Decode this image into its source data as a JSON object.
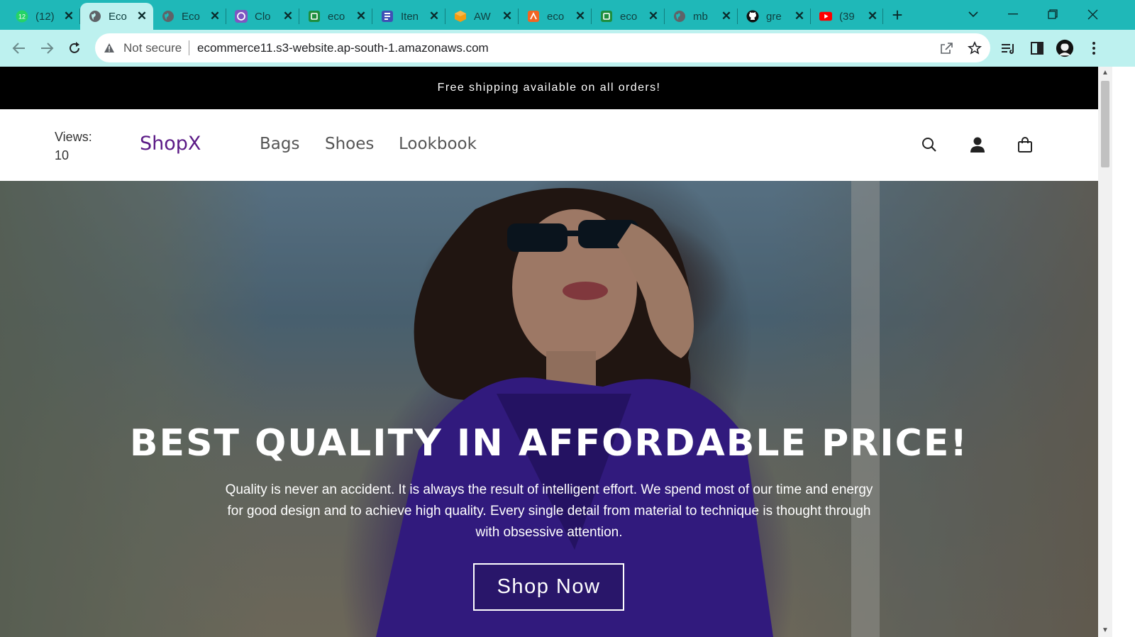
{
  "browser": {
    "tabs": [
      {
        "title": "(12)",
        "icon": "whatsapp-icon",
        "color": "#25d366"
      },
      {
        "title": "Eco",
        "icon": "globe-icon",
        "color": "#5f6368",
        "active": true
      },
      {
        "title": "Eco",
        "icon": "globe-icon",
        "color": "#5f6368"
      },
      {
        "title": "Clo",
        "icon": "cloud-app-icon",
        "color": "#7e57c2"
      },
      {
        "title": "eco",
        "icon": "green-store-icon",
        "color": "#1e8e3e"
      },
      {
        "title": "Iten",
        "icon": "doc-icon",
        "color": "#3f51b5"
      },
      {
        "title": "AW",
        "icon": "aws-cube-icon",
        "color": "#f39c12"
      },
      {
        "title": "eco",
        "icon": "rss-icon",
        "color": "#f26522"
      },
      {
        "title": "eco",
        "icon": "green-store-icon",
        "color": "#1e8e3e"
      },
      {
        "title": "mb",
        "icon": "globe-icon",
        "color": "#5f6368"
      },
      {
        "title": "gre",
        "icon": "github-icon",
        "color": "#111111"
      },
      {
        "title": "(39",
        "icon": "youtube-icon",
        "color": "#ff0000"
      }
    ],
    "tab_close_glyph": "✕",
    "new_tab_glyph": "+",
    "security_label": "Not secure",
    "url": "ecommerce11.s3-website.ap-south-1.amazonaws.com",
    "accent_color": "#1fb8b8"
  },
  "site": {
    "announcement": "Free shipping available on all orders!",
    "views_label": "Views:",
    "views_count": "10",
    "logo": "ShopX",
    "nav": [
      {
        "label": "Bags"
      },
      {
        "label": "Shoes"
      },
      {
        "label": "Lookbook"
      }
    ],
    "brand_color": "#5b1a86"
  },
  "hero": {
    "title": "BEST QUALITY IN AFFORDABLE PRICE!",
    "text": "Quality is never an accident. It is always the result of intelligent effort. We spend most of our time and energy for good design and to achieve high quality. Every single detail from material to technique is thought through with obsessive attention.",
    "cta": "Shop Now"
  }
}
